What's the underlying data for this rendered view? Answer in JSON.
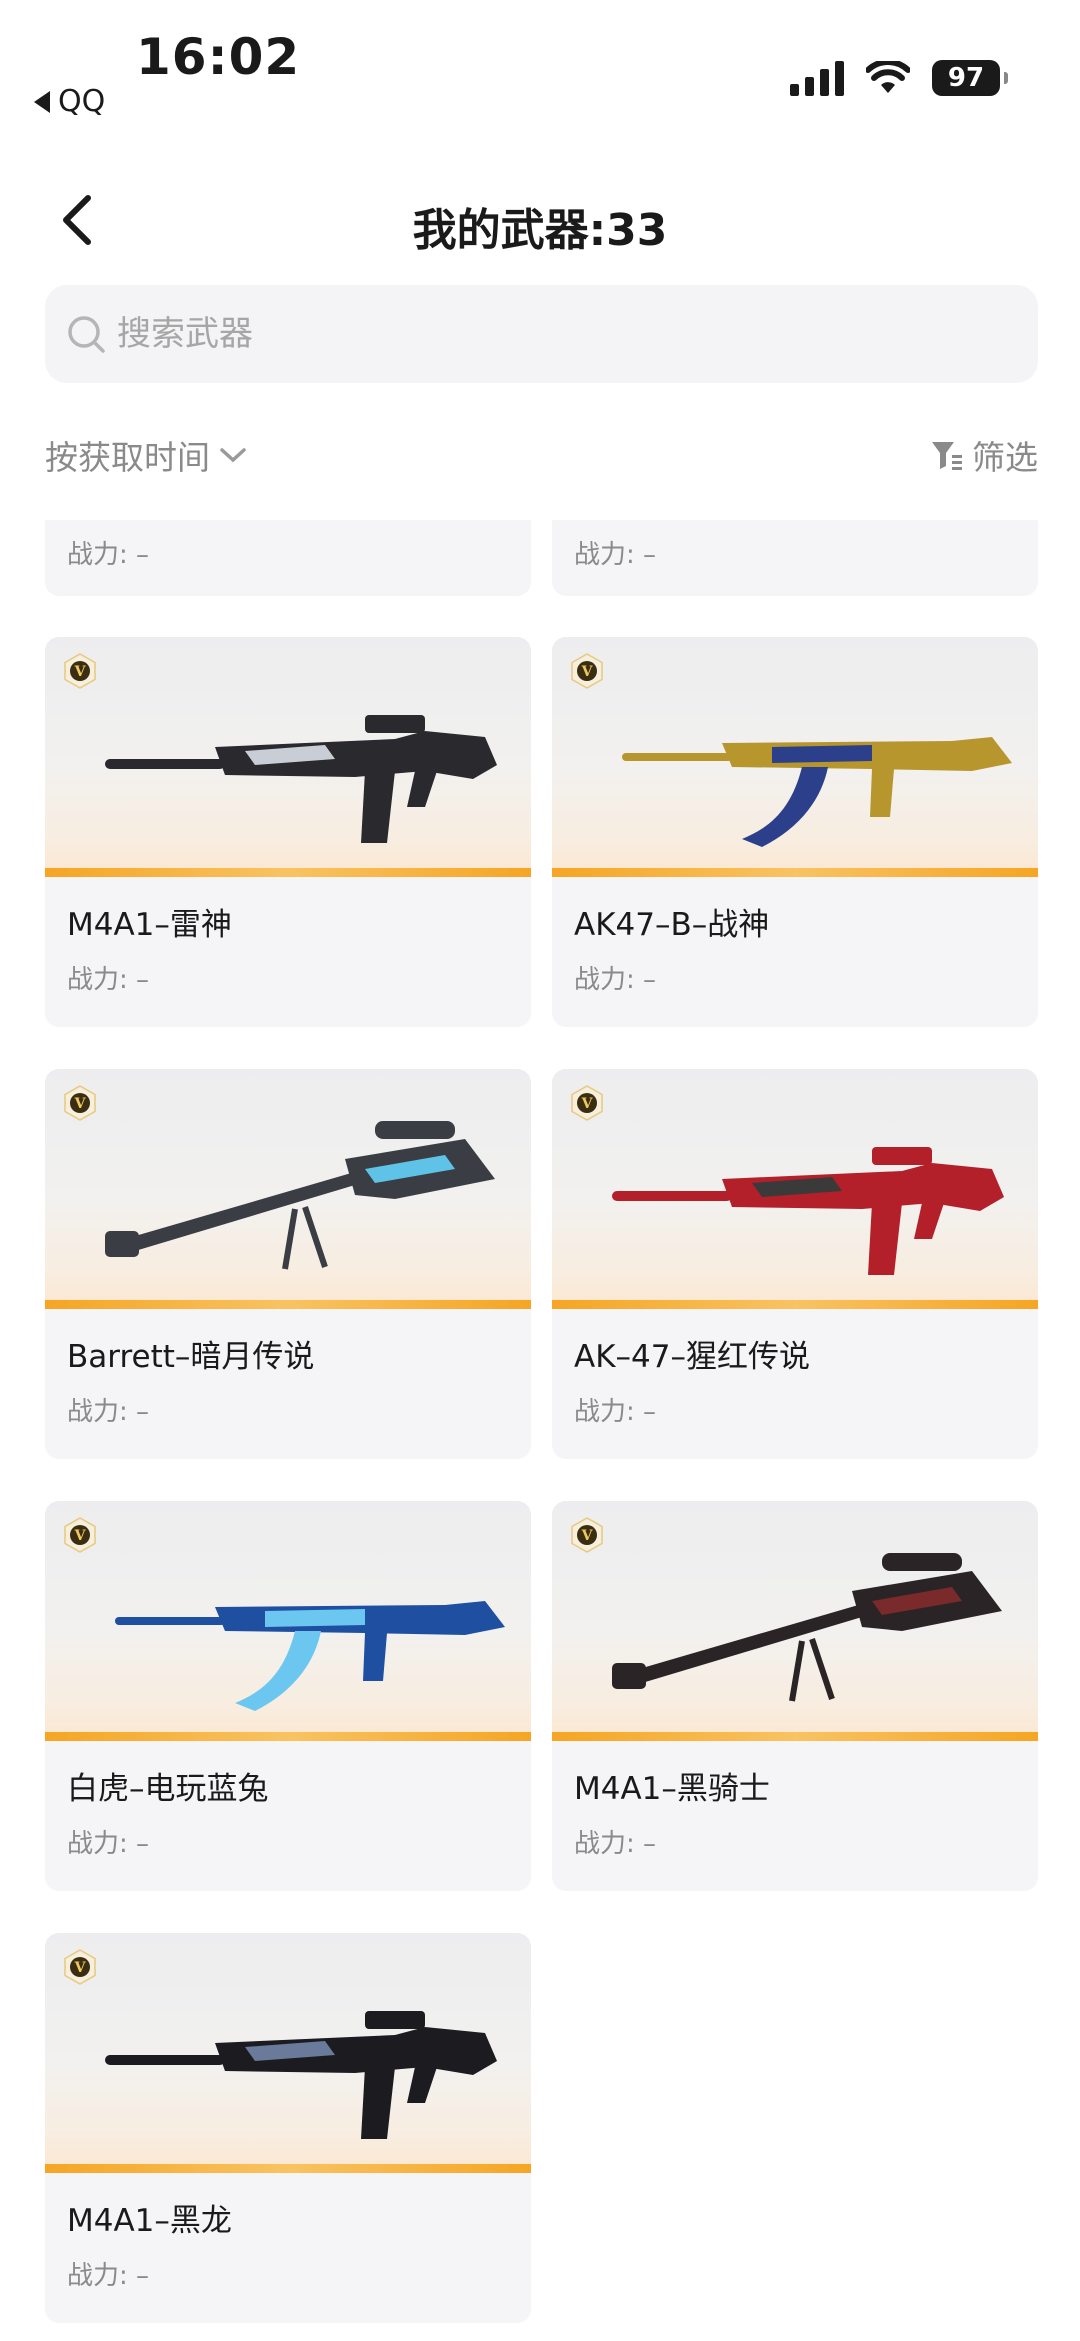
{
  "status_bar": {
    "time": "16:02",
    "back_app": "QQ",
    "battery": "97",
    "icons": [
      "signal-icon",
      "wifi-icon",
      "battery-icon"
    ]
  },
  "nav": {
    "title": "我的武器:33",
    "back_icon": "chevron-left-icon"
  },
  "search": {
    "placeholder": "搜索武器",
    "icon": "search-icon"
  },
  "sort": {
    "label": "按获取时间",
    "filter_label": "筛选"
  },
  "partial_row": [
    {
      "power": "战力: –"
    },
    {
      "power": "战力: –"
    }
  ],
  "weapons": [
    {
      "name": "M4A1–雷神",
      "power": "战力: –",
      "colors": [
        "#2a2a2e",
        "#c9ced6"
      ]
    },
    {
      "name": "AK47–B–战神",
      "power": "战力: –",
      "colors": [
        "#b8962e",
        "#2c3f8a"
      ]
    },
    {
      "name": "Barrett–暗月传说",
      "power": "战力: –",
      "colors": [
        "#3a3d44",
        "#5fc3e8"
      ]
    },
    {
      "name": "AK–47–猩红传说",
      "power": "战力: –",
      "colors": [
        "#b3202a",
        "#3a3a3a"
      ]
    },
    {
      "name": "白虎–电玩蓝兔",
      "power": "战力: –",
      "colors": [
        "#1e4fa0",
        "#6cc7f0"
      ]
    },
    {
      "name": "M4A1–黑骑士",
      "power": "战力: –",
      "colors": [
        "#2a2426",
        "#7a2a2a"
      ]
    },
    {
      "name": "M4A1–黑龙",
      "power": "战力: –",
      "colors": [
        "#1c1c20",
        "#6a7a9a"
      ]
    }
  ],
  "theme": {
    "accent": "#f5a623",
    "card_bg": "#f5f5f7",
    "muted_text": "#8a8a8a"
  }
}
